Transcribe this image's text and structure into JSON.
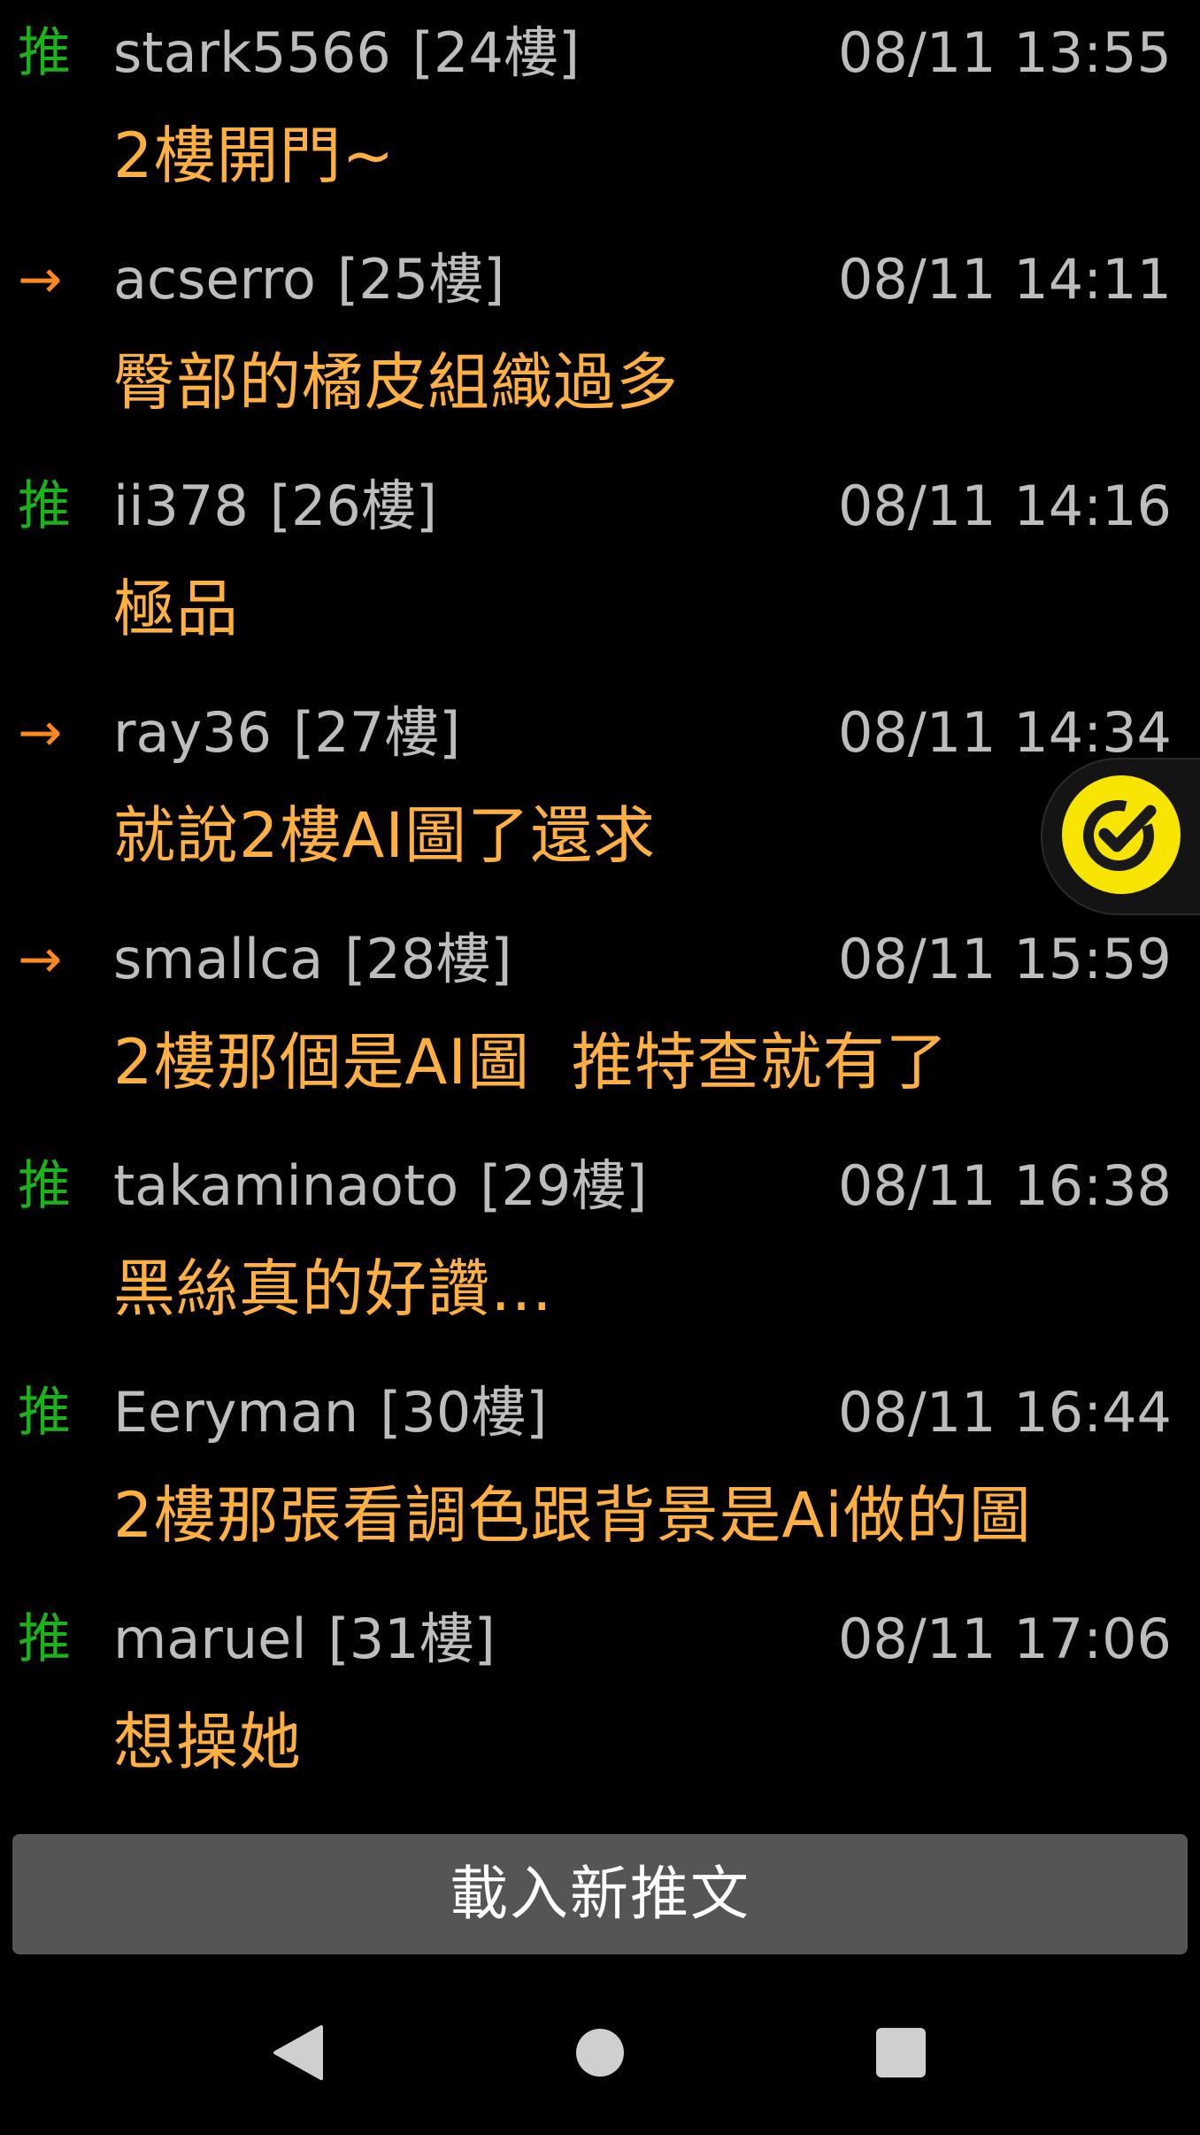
{
  "comments": [
    {
      "type": "推",
      "kind": "push",
      "user": "stark5566",
      "floor": "[24樓]",
      "time": "08/11 13:55",
      "content": "2樓開門~"
    },
    {
      "type": "→",
      "kind": "arrow",
      "user": "acserro",
      "floor": "[25樓]",
      "time": "08/11 14:11",
      "content": "臀部的橘皮組織過多"
    },
    {
      "type": "推",
      "kind": "push",
      "user": "ii378",
      "floor": "[26樓]",
      "time": "08/11 14:16",
      "content": "極品"
    },
    {
      "type": "→",
      "kind": "arrow",
      "user": "ray36",
      "floor": "[27樓]",
      "time": "08/11 14:34",
      "content": "就說2樓AI圖了還求"
    },
    {
      "type": "→",
      "kind": "arrow",
      "user": "smallca",
      "floor": "[28樓]",
      "time": "08/11 15:59",
      "content": "2樓那個是AI圖  推特查就有了"
    },
    {
      "type": "推",
      "kind": "push",
      "user": "takaminaoto",
      "floor": "[29樓]",
      "time": "08/11 16:38",
      "content": "黑絲真的好讚…"
    },
    {
      "type": "推",
      "kind": "push",
      "user": "Eeryman",
      "floor": "[30樓]",
      "time": "08/11 16:44",
      "content": "2樓那張看調色跟背景是Ai做的圖"
    },
    {
      "type": "推",
      "kind": "push",
      "user": "maruel",
      "floor": "[31樓]",
      "time": "08/11 17:06",
      "content": "想操她"
    }
  ],
  "load_button": {
    "label": "載入新推文"
  },
  "floating_button": {
    "icon": "check-circle-icon",
    "color": "#f7e400"
  },
  "navbar": {
    "back": "back-triangle-icon",
    "home": "home-circle-icon",
    "recents": "recents-square-icon"
  },
  "colors": {
    "push": "#19b419",
    "arrow": "#ff8a1c",
    "content": "#ffb040",
    "meta": "#bdbdbd",
    "button_bg": "#555555"
  }
}
